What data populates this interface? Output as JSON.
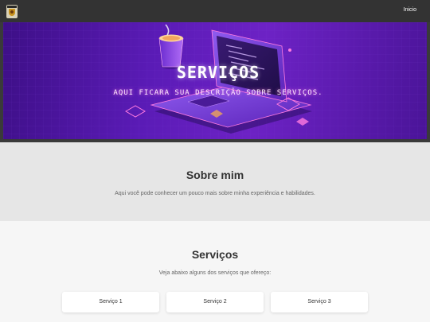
{
  "header": {
    "logo_icon": "logo-badge-icon",
    "nav_link": "Inicio"
  },
  "hero": {
    "title": "SERVIÇOS",
    "subtitle": "AQUI FICARA SUA DESCRIÇÃO SOBRE SERVIÇOS.",
    "illustration": "laptop-coffee-illustration",
    "accent_colors": [
      "#5a1bb6",
      "#ff6ad5",
      "#ffb347"
    ]
  },
  "about": {
    "title": "Sobre mim",
    "text": "Aqui você pode conhecer um pouco mais sobre minha experiência e habilidades."
  },
  "services": {
    "title": "Serviços",
    "text": "Veja abaixo alguns dos serviços que ofereço:",
    "cards": [
      {
        "label": "Serviço 1"
      },
      {
        "label": "Serviço 2"
      },
      {
        "label": "Serviço 3"
      }
    ]
  }
}
